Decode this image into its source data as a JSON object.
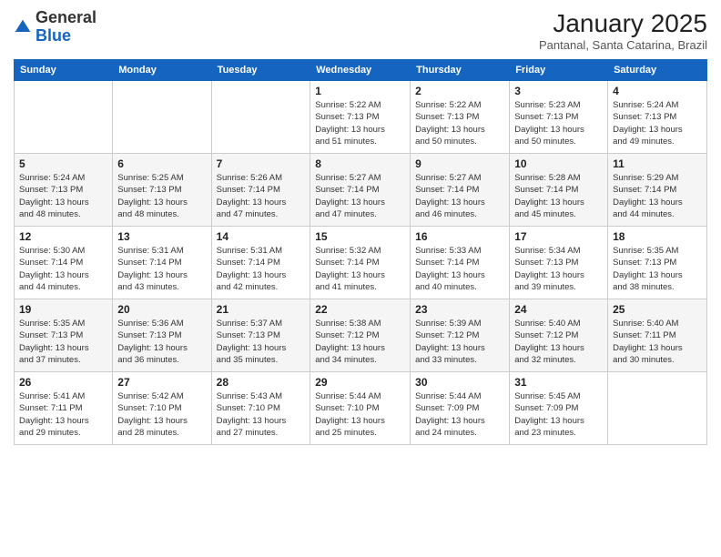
{
  "header": {
    "logo": {
      "general": "General",
      "blue": "Blue"
    },
    "title": "January 2025",
    "subtitle": "Pantanal, Santa Catarina, Brazil"
  },
  "days_of_week": [
    "Sunday",
    "Monday",
    "Tuesday",
    "Wednesday",
    "Thursday",
    "Friday",
    "Saturday"
  ],
  "weeks": [
    [
      {
        "day": "",
        "info": ""
      },
      {
        "day": "",
        "info": ""
      },
      {
        "day": "",
        "info": ""
      },
      {
        "day": "1",
        "info": "Sunrise: 5:22 AM\nSunset: 7:13 PM\nDaylight: 13 hours\nand 51 minutes."
      },
      {
        "day": "2",
        "info": "Sunrise: 5:22 AM\nSunset: 7:13 PM\nDaylight: 13 hours\nand 50 minutes."
      },
      {
        "day": "3",
        "info": "Sunrise: 5:23 AM\nSunset: 7:13 PM\nDaylight: 13 hours\nand 50 minutes."
      },
      {
        "day": "4",
        "info": "Sunrise: 5:24 AM\nSunset: 7:13 PM\nDaylight: 13 hours\nand 49 minutes."
      }
    ],
    [
      {
        "day": "5",
        "info": "Sunrise: 5:24 AM\nSunset: 7:13 PM\nDaylight: 13 hours\nand 48 minutes."
      },
      {
        "day": "6",
        "info": "Sunrise: 5:25 AM\nSunset: 7:13 PM\nDaylight: 13 hours\nand 48 minutes."
      },
      {
        "day": "7",
        "info": "Sunrise: 5:26 AM\nSunset: 7:14 PM\nDaylight: 13 hours\nand 47 minutes."
      },
      {
        "day": "8",
        "info": "Sunrise: 5:27 AM\nSunset: 7:14 PM\nDaylight: 13 hours\nand 47 minutes."
      },
      {
        "day": "9",
        "info": "Sunrise: 5:27 AM\nSunset: 7:14 PM\nDaylight: 13 hours\nand 46 minutes."
      },
      {
        "day": "10",
        "info": "Sunrise: 5:28 AM\nSunset: 7:14 PM\nDaylight: 13 hours\nand 45 minutes."
      },
      {
        "day": "11",
        "info": "Sunrise: 5:29 AM\nSunset: 7:14 PM\nDaylight: 13 hours\nand 44 minutes."
      }
    ],
    [
      {
        "day": "12",
        "info": "Sunrise: 5:30 AM\nSunset: 7:14 PM\nDaylight: 13 hours\nand 44 minutes."
      },
      {
        "day": "13",
        "info": "Sunrise: 5:31 AM\nSunset: 7:14 PM\nDaylight: 13 hours\nand 43 minutes."
      },
      {
        "day": "14",
        "info": "Sunrise: 5:31 AM\nSunset: 7:14 PM\nDaylight: 13 hours\nand 42 minutes."
      },
      {
        "day": "15",
        "info": "Sunrise: 5:32 AM\nSunset: 7:14 PM\nDaylight: 13 hours\nand 41 minutes."
      },
      {
        "day": "16",
        "info": "Sunrise: 5:33 AM\nSunset: 7:14 PM\nDaylight: 13 hours\nand 40 minutes."
      },
      {
        "day": "17",
        "info": "Sunrise: 5:34 AM\nSunset: 7:13 PM\nDaylight: 13 hours\nand 39 minutes."
      },
      {
        "day": "18",
        "info": "Sunrise: 5:35 AM\nSunset: 7:13 PM\nDaylight: 13 hours\nand 38 minutes."
      }
    ],
    [
      {
        "day": "19",
        "info": "Sunrise: 5:35 AM\nSunset: 7:13 PM\nDaylight: 13 hours\nand 37 minutes."
      },
      {
        "day": "20",
        "info": "Sunrise: 5:36 AM\nSunset: 7:13 PM\nDaylight: 13 hours\nand 36 minutes."
      },
      {
        "day": "21",
        "info": "Sunrise: 5:37 AM\nSunset: 7:13 PM\nDaylight: 13 hours\nand 35 minutes."
      },
      {
        "day": "22",
        "info": "Sunrise: 5:38 AM\nSunset: 7:12 PM\nDaylight: 13 hours\nand 34 minutes."
      },
      {
        "day": "23",
        "info": "Sunrise: 5:39 AM\nSunset: 7:12 PM\nDaylight: 13 hours\nand 33 minutes."
      },
      {
        "day": "24",
        "info": "Sunrise: 5:40 AM\nSunset: 7:12 PM\nDaylight: 13 hours\nand 32 minutes."
      },
      {
        "day": "25",
        "info": "Sunrise: 5:40 AM\nSunset: 7:11 PM\nDaylight: 13 hours\nand 30 minutes."
      }
    ],
    [
      {
        "day": "26",
        "info": "Sunrise: 5:41 AM\nSunset: 7:11 PM\nDaylight: 13 hours\nand 29 minutes."
      },
      {
        "day": "27",
        "info": "Sunrise: 5:42 AM\nSunset: 7:10 PM\nDaylight: 13 hours\nand 28 minutes."
      },
      {
        "day": "28",
        "info": "Sunrise: 5:43 AM\nSunset: 7:10 PM\nDaylight: 13 hours\nand 27 minutes."
      },
      {
        "day": "29",
        "info": "Sunrise: 5:44 AM\nSunset: 7:10 PM\nDaylight: 13 hours\nand 25 minutes."
      },
      {
        "day": "30",
        "info": "Sunrise: 5:44 AM\nSunset: 7:09 PM\nDaylight: 13 hours\nand 24 minutes."
      },
      {
        "day": "31",
        "info": "Sunrise: 5:45 AM\nSunset: 7:09 PM\nDaylight: 13 hours\nand 23 minutes."
      },
      {
        "day": "",
        "info": ""
      }
    ]
  ]
}
